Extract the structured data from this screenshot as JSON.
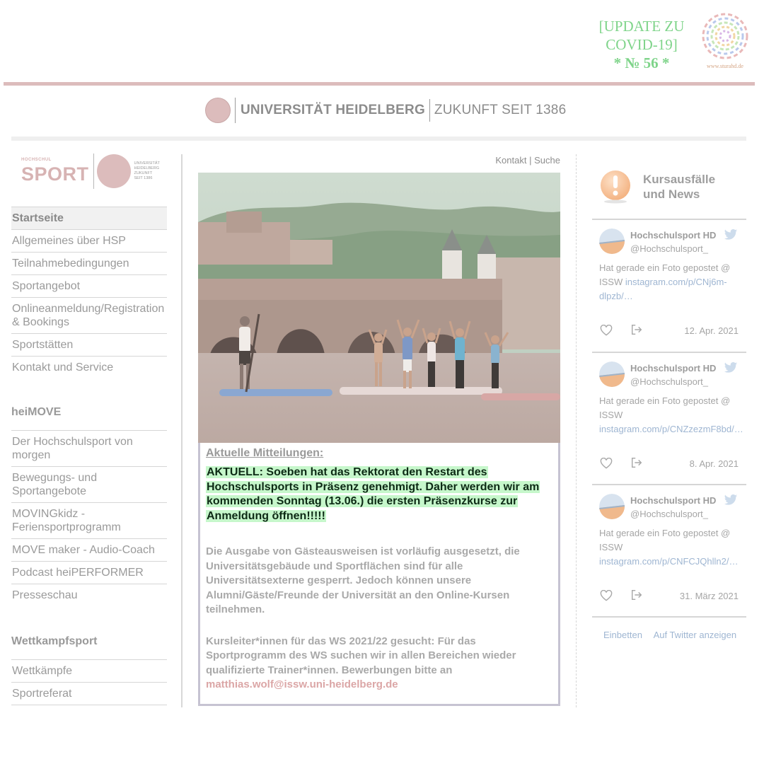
{
  "banner": {
    "update_line1": "[UPDATE ZU",
    "update_line2": "COVID-19]",
    "update_number": "* № 56 *",
    "stura_url": "www.sturahd.de",
    "accent_green": "#7fd48a"
  },
  "university": {
    "name": "UNIVERSITÄT HEIDELBERG",
    "slogan": "ZUKUNFT SEIT 1386"
  },
  "sport_logo": {
    "small_label": "HOCHSCHUL",
    "word": "SPORT",
    "uni_small_1": "UNIVERSITÄT",
    "uni_small_2": "HEIDELBERG",
    "uni_small_3": "ZUKUNFT",
    "uni_small_4": "SEIT 1386"
  },
  "nav": {
    "main": [
      "Startseite",
      "Allgemeines über HSP",
      "Teilnahmebedingungen",
      "Sportangebot",
      "Onlineanmeldung/Registration & Bookings",
      "Sportstätten",
      "Kontakt und Service"
    ],
    "heimove_heading": "heiMOVE",
    "heimove": [
      "Der Hochschulsport von morgen",
      "Bewegungs- und Sportangebote",
      "MOVINGkidz - Feriensportprogramm",
      "MOVE maker - Audio-Coach",
      "Podcast heiPERFORMER",
      "Presseschau"
    ],
    "wettkampf_heading": "Wettkampfsport",
    "wettkampf": [
      "Wettkämpfe",
      "Sportreferat"
    ]
  },
  "top_links": {
    "kontakt": "Kontakt",
    "separator": "|",
    "suche": "Suche"
  },
  "notice": {
    "title": "Aktuelle Mitteilungen:",
    "highlight": "AKTUELL: Soeben hat das Rektorat den Restart des Hochschulsports in Präsenz genehmigt. Daher werden wir am kommenden Sonntag (13.06.) die ersten Präsenzkurse zur Anmeldung öffnen!!!!!",
    "paragraph1": "Die Ausgabe von Gästeausweisen ist vorläufig ausgesetzt, die Universitätsgebäude und Sportflächen sind für alle Universitätsexterne gesperrt. Jedoch können unsere Alumni/Gäste/Freunde der Universität an den Online-Kursen teilnehmen.",
    "paragraph2_text": "Kursleiter*innen für das WS 2021/22 gesucht: Für das Sportprogramm des WS suchen wir in allen Bereichen wieder qualifizierte Trainer*innen. Bewerbungen bitte an ",
    "paragraph2_email": "matthias.wolf@issw.uni-heidelberg.de",
    "highlight_color": "#c6f7cb"
  },
  "news": {
    "title_line1": "Kursausfälle",
    "title_line2": "und News",
    "tweets": [
      {
        "name": "Hochschulsport HD",
        "handle": "@Hochschulsport_",
        "text": "Hat gerade ein Foto gepostet @ ISSW ",
        "url": "instagram.com/p/CNj6m-dlpzb/…",
        "date": "12. Apr. 2021"
      },
      {
        "name": "Hochschulsport HD",
        "handle": "@Hochschulsport_",
        "text": "Hat gerade ein Foto gepostet @ ISSW ",
        "url": "instagram.com/p/CNZzezmF8bd/…",
        "date": "8. Apr. 2021"
      },
      {
        "name": "Hochschulsport HD",
        "handle": "@Hochschulsport_",
        "text": "Hat gerade ein Foto gepostet @ ISSW ",
        "url": "instagram.com/p/CNFCJQhlln2/…",
        "date": "31. März 2021"
      }
    ],
    "embed_label": "Einbetten",
    "twitter_label": "Auf Twitter anzeigen"
  }
}
